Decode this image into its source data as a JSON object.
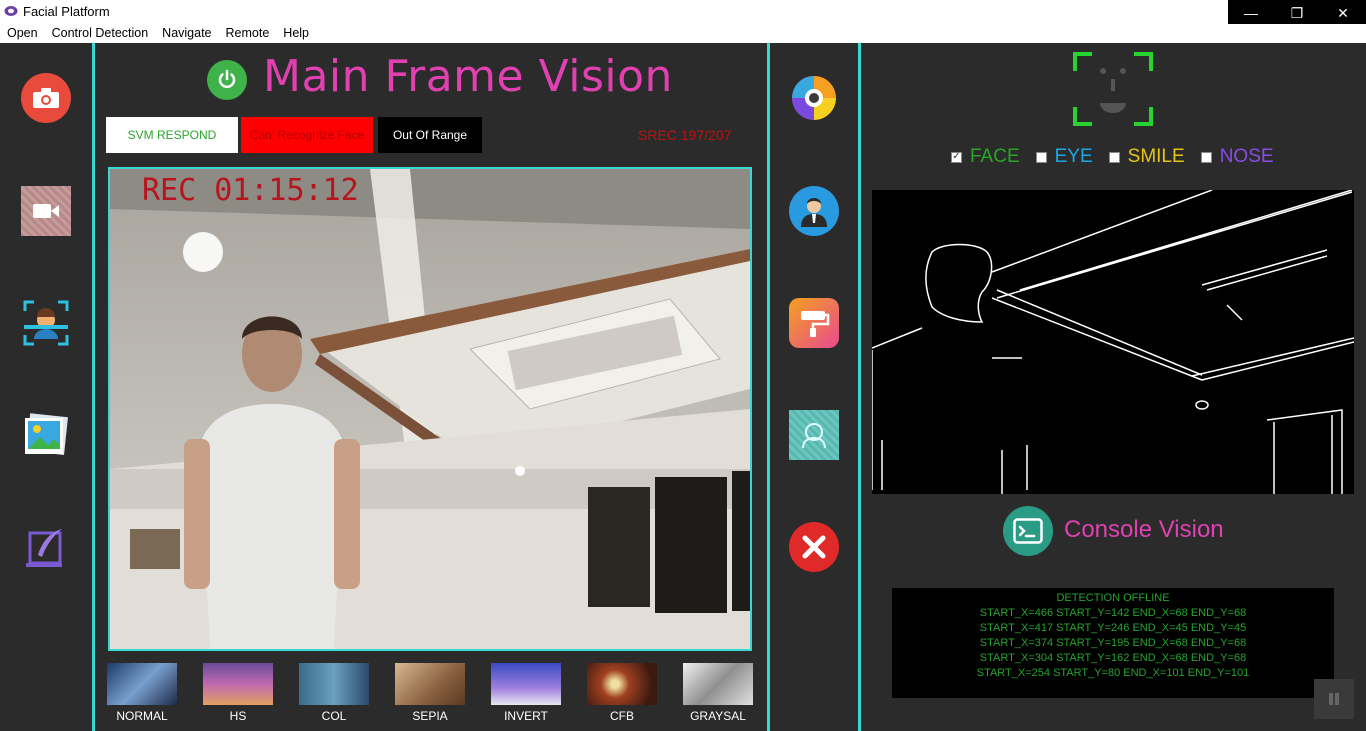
{
  "window": {
    "title": "Facial Platform",
    "minimize": "—",
    "maximize": "❐",
    "close": "✕"
  },
  "menu": [
    "Open",
    "Control Detection",
    "Navigate",
    "Remote",
    "Help"
  ],
  "main": {
    "title": "Main Frame Vision",
    "status": {
      "svm": "SVM RESPOND",
      "recognize": "Can' Recognize Face",
      "range": "Out Of Range",
      "srec": "SREC 197/207"
    },
    "rec_time": "REC 01:15:12",
    "filters": [
      "NORMAL",
      "HS",
      "COL",
      "SEPIA",
      "INVERT",
      "CFB",
      "GRAYSAL"
    ]
  },
  "detection": {
    "checks": [
      {
        "label": "FACE",
        "checked": true,
        "color": "#2aa52a"
      },
      {
        "label": "EYE",
        "checked": false,
        "color": "#1aa8e6"
      },
      {
        "label": "SMILE",
        "checked": false,
        "color": "#e6c21a"
      },
      {
        "label": "NOSE",
        "checked": false,
        "color": "#8a4ce6"
      }
    ]
  },
  "console": {
    "title": "Console Vision",
    "lines": [
      "DETECTION OFFLINE",
      "START_X=466 START_Y=142 END_X=68 END_Y=68",
      "START_X=417 START_Y=246 END_X=45 END_Y=45",
      "START_X=374 START_Y=195 END_X=68 END_Y=68",
      "START_X=304 START_Y=162 END_X=68 END_Y=68",
      "START_X=254 START_Y=80 END_X=101 END_Y=101"
    ]
  },
  "colors": {
    "accent": "#3ad6d2",
    "title": "#e040b0",
    "console_text": "#27a32e",
    "rec": "#b8141e"
  }
}
